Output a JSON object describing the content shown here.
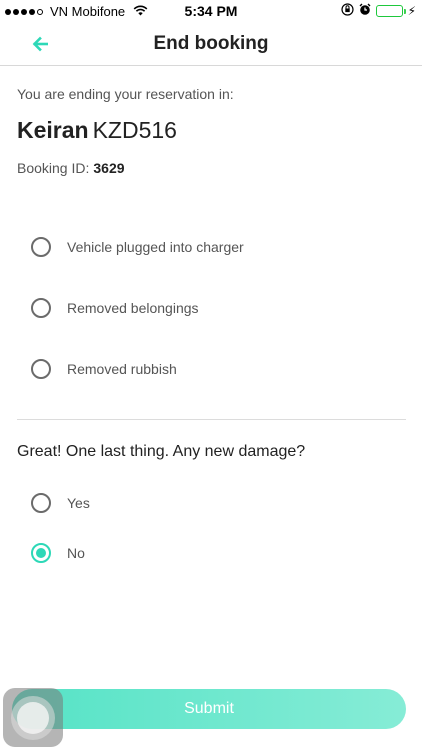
{
  "status_bar": {
    "carrier": "VN Mobifone",
    "time": "5:34 PM"
  },
  "nav": {
    "title": "End booking",
    "back_icon": "arrow-left-icon"
  },
  "reservation": {
    "intro": "You are ending your reservation in:",
    "vehicle_name": "Keiran",
    "vehicle_plate": "KZD516",
    "booking_label": "Booking ID:",
    "booking_id": "3629"
  },
  "checklist": [
    {
      "label": "Vehicle plugged into charger",
      "checked": false
    },
    {
      "label": "Removed belongings",
      "checked": false
    },
    {
      "label": "Removed rubbish",
      "checked": false
    }
  ],
  "damage": {
    "question": "Great! One last thing. Any new damage?",
    "options": [
      {
        "label": "Yes",
        "selected": false
      },
      {
        "label": "No",
        "selected": true
      }
    ]
  },
  "submit_label": "Submit",
  "colors": {
    "accent": "#2dd8b7",
    "battery": "#3ad14f"
  }
}
